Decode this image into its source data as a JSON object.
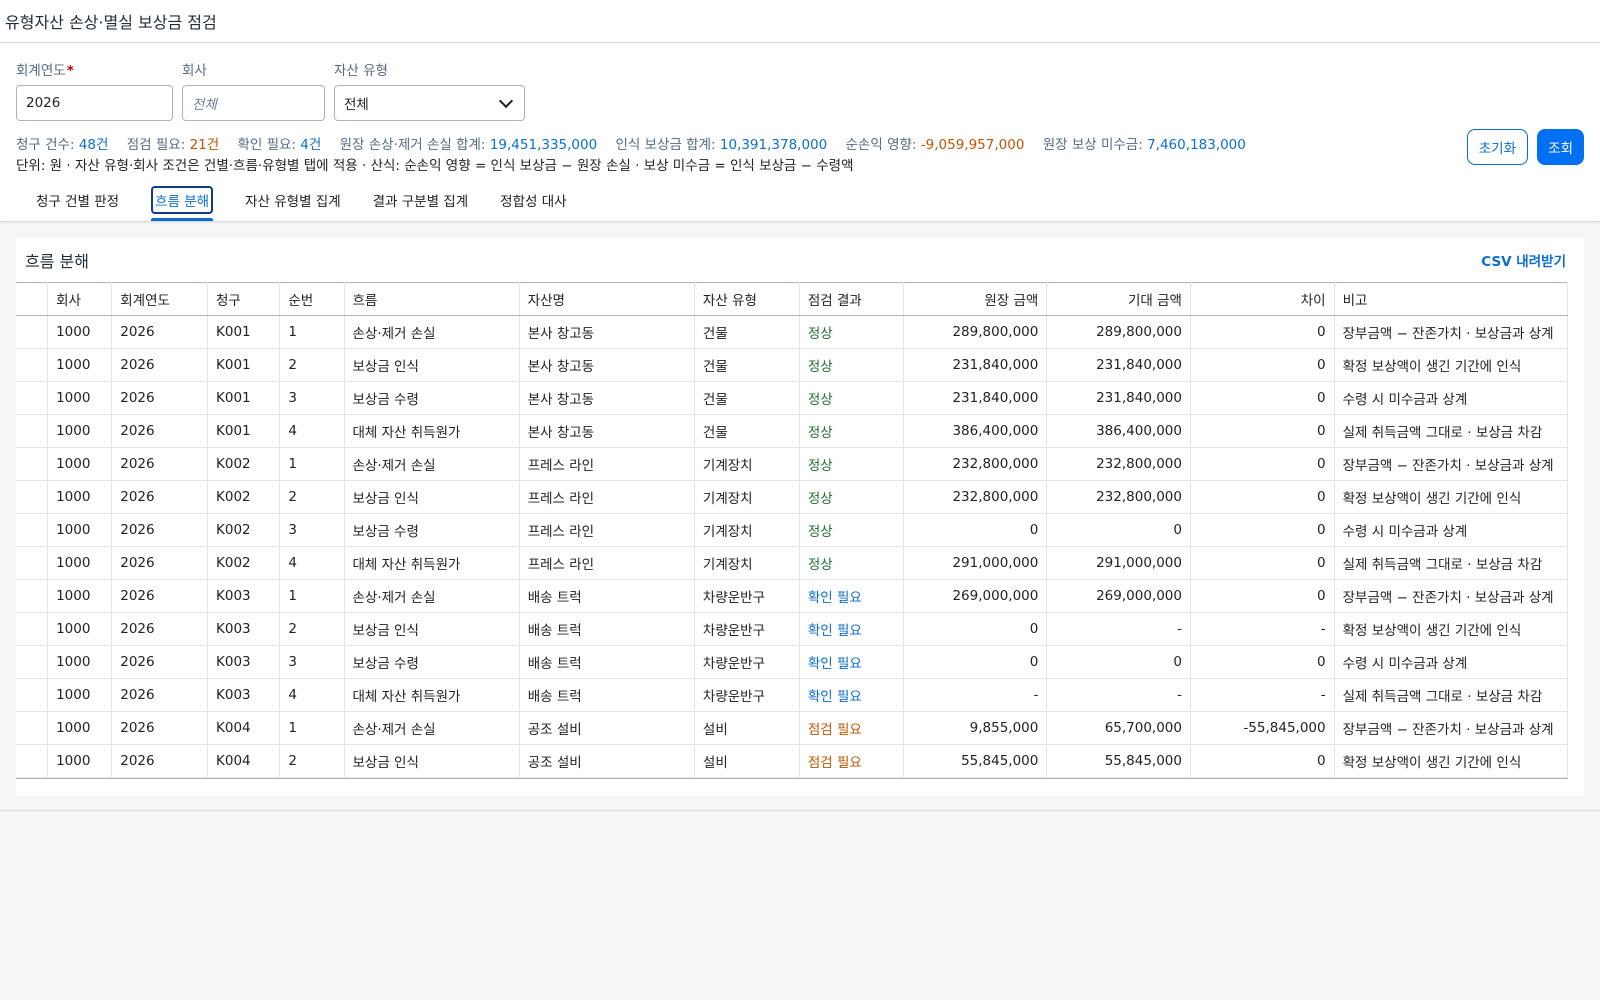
{
  "app_title": "유형자산 손상·멸실 보상금 점검",
  "filters": {
    "fiscal_year": {
      "label": "회계연도",
      "required": "*",
      "value": "2026"
    },
    "company": {
      "label": "회사",
      "placeholder": "전체"
    },
    "asset_type": {
      "label": "자산 유형",
      "value": "전체"
    },
    "reset_label": "초기화",
    "go_label": "조회"
  },
  "summary": {
    "claims_label": "청구 건수:",
    "claims_value": "48건",
    "check_label": "점검 필요:",
    "check_value": "21건",
    "confirm_label": "확인 필요:",
    "confirm_value": "4건",
    "loss_label": "원장 손상·제거 손실 합계:",
    "loss_value": "19,451,335,000",
    "comp_label": "인식 보상금 합계:",
    "comp_value": "10,391,378,000",
    "net_label": "순손익 영향:",
    "net_value": "-9,059,957,000",
    "recv_label": "원장 보상 미수금:",
    "recv_value": "7,460,183,000",
    "note": "단위: 원 · 자산 유형·회사 조건은 건별·흐름·유형별 탭에 적용 · 산식: 순손익 영향 = 인식 보상금 − 원장 손실 · 보상 미수금 = 인식 보상금 − 수령액"
  },
  "tabs": [
    "청구 건별 판정",
    "흐름 분해",
    "자산 유형별 집계",
    "결과 구분별 집계",
    "정합성 대사"
  ],
  "panel": {
    "title": "흐름 분해",
    "csv_label": "CSV 내려받기"
  },
  "columns": [
    "회사",
    "회계연도",
    "청구",
    "순번",
    "흐름",
    "자산명",
    "자산 유형",
    "점검 결과",
    "원장 금액",
    "기대 금액",
    "차이",
    "비고"
  ],
  "rows": [
    [
      "1000",
      "2026",
      "K001",
      "1",
      "손상·제거 손실",
      "본사 창고동",
      "건물",
      "정상",
      "289,800,000",
      "289,800,000",
      "0",
      "장부금액 − 잔존가치 · 보상금과 상계"
    ],
    [
      "1000",
      "2026",
      "K001",
      "2",
      "보상금 인식",
      "본사 창고동",
      "건물",
      "정상",
      "231,840,000",
      "231,840,000",
      "0",
      "확정 보상액이 생긴 기간에 인식"
    ],
    [
      "1000",
      "2026",
      "K001",
      "3",
      "보상금 수령",
      "본사 창고동",
      "건물",
      "정상",
      "231,840,000",
      "231,840,000",
      "0",
      "수령 시 미수금과 상계"
    ],
    [
      "1000",
      "2026",
      "K001",
      "4",
      "대체 자산 취득원가",
      "본사 창고동",
      "건물",
      "정상",
      "386,400,000",
      "386,400,000",
      "0",
      "실제 취득금액 그대로 · 보상금 차감"
    ],
    [
      "1000",
      "2026",
      "K002",
      "1",
      "손상·제거 손실",
      "프레스 라인",
      "기계장치",
      "정상",
      "232,800,000",
      "232,800,000",
      "0",
      "장부금액 − 잔존가치 · 보상금과 상계"
    ],
    [
      "1000",
      "2026",
      "K002",
      "2",
      "보상금 인식",
      "프레스 라인",
      "기계장치",
      "정상",
      "232,800,000",
      "232,800,000",
      "0",
      "확정 보상액이 생긴 기간에 인식"
    ],
    [
      "1000",
      "2026",
      "K002",
      "3",
      "보상금 수령",
      "프레스 라인",
      "기계장치",
      "정상",
      "0",
      "0",
      "0",
      "수령 시 미수금과 상계"
    ],
    [
      "1000",
      "2026",
      "K002",
      "4",
      "대체 자산 취득원가",
      "프레스 라인",
      "기계장치",
      "정상",
      "291,000,000",
      "291,000,000",
      "0",
      "실제 취득금액 그대로 · 보상금 차감"
    ],
    [
      "1000",
      "2026",
      "K003",
      "1",
      "손상·제거 손실",
      "배송 트럭",
      "차량운반구",
      "확인 필요",
      "269,000,000",
      "269,000,000",
      "0",
      "장부금액 − 잔존가치 · 보상금과 상계"
    ],
    [
      "1000",
      "2026",
      "K003",
      "2",
      "보상금 인식",
      "배송 트럭",
      "차량운반구",
      "확인 필요",
      "0",
      "-",
      "-",
      "확정 보상액이 생긴 기간에 인식"
    ],
    [
      "1000",
      "2026",
      "K003",
      "3",
      "보상금 수령",
      "배송 트럭",
      "차량운반구",
      "확인 필요",
      "0",
      "0",
      "0",
      "수령 시 미수금과 상계"
    ],
    [
      "1000",
      "2026",
      "K003",
      "4",
      "대체 자산 취득원가",
      "배송 트럭",
      "차량운반구",
      "확인 필요",
      "-",
      "-",
      "-",
      "실제 취득금액 그대로 · 보상금 차감"
    ],
    [
      "1000",
      "2026",
      "K004",
      "1",
      "손상·제거 손실",
      "공조 설비",
      "설비",
      "점검 필요",
      "9,855,000",
      "65,700,000",
      "-55,845,000",
      "장부금액 − 잔존가치 · 보상금과 상계"
    ],
    [
      "1000",
      "2026",
      "K004",
      "2",
      "보상금 인식",
      "공조 설비",
      "설비",
      "점검 필요",
      "55,845,000",
      "55,845,000",
      "0",
      "확정 보상액이 생긴 기간에 인식"
    ]
  ]
}
